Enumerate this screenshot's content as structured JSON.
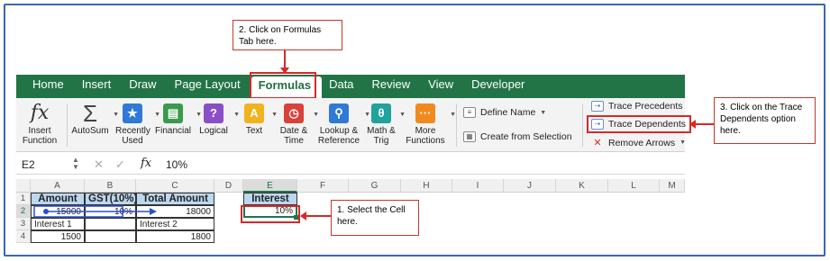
{
  "callouts": {
    "step2": "2. Click on Formulas Tab here.",
    "step3": "3. Click on the Trace Dependents option here.",
    "step1": "1. Select the Cell here."
  },
  "tabs": [
    "Home",
    "Insert",
    "Draw",
    "Page Layout",
    "Formulas",
    "Data",
    "Review",
    "View",
    "Developer"
  ],
  "ribbon": {
    "insert_function": "Insert Function",
    "autosum": "AutoSum",
    "recently_used": "Recently Used",
    "financial": "Financial",
    "logical": "Logical",
    "text": "Text",
    "date_time": "Date & Time",
    "lookup_reference": "Lookup & Reference",
    "math_trig": "Math & Trig",
    "more_functions": "More Functions",
    "define_name": "Define Name",
    "create_from_selection": "Create from Selection",
    "trace_precedents": "Trace Precedents",
    "trace_dependents": "Trace Dependents",
    "remove_arrows": "Remove Arrows"
  },
  "formula_bar": {
    "name_box": "E2",
    "fx": "fx",
    "value": "10%"
  },
  "columns": [
    "A",
    "B",
    "C",
    "D",
    "E",
    "F",
    "G",
    "H",
    "I",
    "J",
    "K",
    "L",
    "M"
  ],
  "rows": [
    "1",
    "2",
    "3",
    "4"
  ],
  "cells": {
    "A1": "Amount",
    "B1": "GST(10%)",
    "C1": "Total Amount",
    "E1": "Interest",
    "A2": "15000",
    "B2": "10%",
    "C2": "18000",
    "E2": "10%",
    "A3": "Interest 1",
    "C3": "Interest 2",
    "A4": "1500",
    "C4": "1800"
  },
  "colors": {
    "ribbon_green": "#227447",
    "callout_red": "#d42a2a",
    "header_fill": "#bdd7ee",
    "trace_arrow": "#2a4fcf"
  }
}
